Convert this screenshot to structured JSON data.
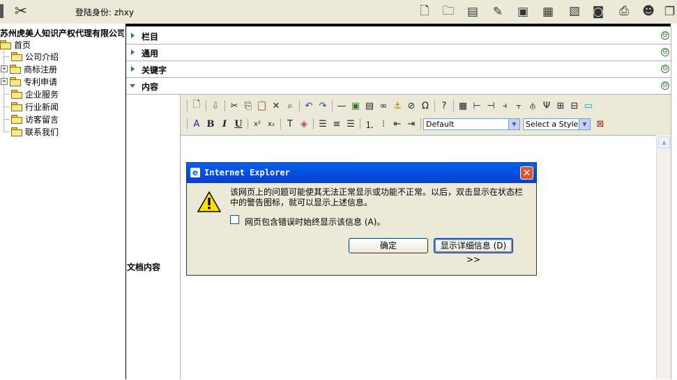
{
  "topbar": {
    "login_text": "登陆身份: zhxy",
    "icons": [
      "tools-icon",
      "new-doc-icon",
      "open-folder-icon",
      "document-icon",
      "edit-icon",
      "cards-icon",
      "layout-icon",
      "image-doc-icon",
      "camera-icon",
      "printer-icon",
      "users-icon",
      "pages-icon"
    ]
  },
  "tree": {
    "company": "苏州虎美人知识产权代理有限公司",
    "root": "首页",
    "items": [
      {
        "label": "公司介绍",
        "expandable": false
      },
      {
        "label": "商标注册",
        "expandable": true
      },
      {
        "label": "专利申请",
        "expandable": true
      },
      {
        "label": "企业服务",
        "expandable": false
      },
      {
        "label": "行业新闻",
        "expandable": false
      },
      {
        "label": "访客留言",
        "expandable": false
      },
      {
        "label": "联系我们",
        "expandable": false
      }
    ],
    "plus_symbol": "+"
  },
  "sections": [
    {
      "label": "栏目",
      "expanded": false
    },
    {
      "label": "通用",
      "expanded": false
    },
    {
      "label": "关键字",
      "expanded": false
    },
    {
      "label": "内容",
      "expanded": true
    }
  ],
  "collapse_symbol": "⊖",
  "content": {
    "doc_label": "文档内容",
    "format_select": "Default",
    "style_select": "Select a Style",
    "bold": "B",
    "italic": "I",
    "underline": "U",
    "omega": "Ω",
    "help": "?"
  },
  "dialog": {
    "title": "Internet Explorer",
    "message": "该网页上的问题可能使其无法正常显示或功能不正常。以后，双击显示在状态栏中的警告图标，就可以显示上述信息。",
    "checkbox_label": "网页包含错误时始终显示该信息 (A)。",
    "checked": false,
    "ok_button": "确定",
    "details_button": "显示详细信息 (D) >>",
    "close_symbol": "✕"
  }
}
